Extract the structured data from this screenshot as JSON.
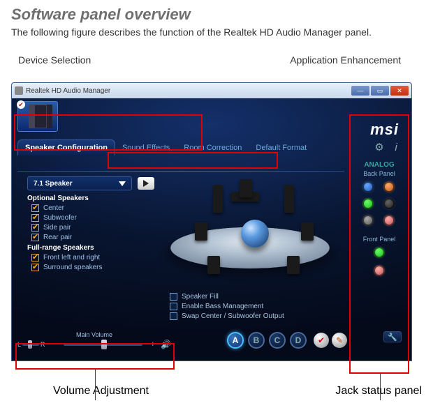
{
  "heading": "Software panel overview",
  "subhead": "The following figure describes the function of the Realtek HD Audio Manager panel.",
  "callouts": {
    "device_selection": "Device Selection",
    "application_enhancement": "Application Enhancement",
    "volume_adjustment": "Volume Adjustment",
    "jack_status_panel": "Jack status panel"
  },
  "window": {
    "title": "Realtek HD Audio Manager",
    "brand": "msi",
    "tabs": [
      {
        "label": "Speaker Configuration",
        "active": true
      },
      {
        "label": "Sound Effects",
        "active": false
      },
      {
        "label": "Room Correction",
        "active": false
      },
      {
        "label": "Default Format",
        "active": false
      }
    ],
    "speaker_mode": "7.1 Speaker",
    "optional_heading": "Optional Speakers",
    "optional": [
      {
        "label": "Center",
        "checked": true
      },
      {
        "label": "Subwoofer",
        "checked": true
      },
      {
        "label": "Side pair",
        "checked": true
      },
      {
        "label": "Rear pair",
        "checked": true
      }
    ],
    "fullrange_heading": "Full-range Speakers",
    "fullrange": [
      {
        "label": "Front left and right",
        "checked": true
      },
      {
        "label": "Surround speakers",
        "checked": true
      }
    ],
    "extra_opts": [
      {
        "label": "Speaker Fill",
        "checked": false
      },
      {
        "label": "Enable Bass Management",
        "checked": false
      },
      {
        "label": "Swap Center / Subwoofer Output",
        "checked": false
      }
    ],
    "side_panel": {
      "analog": "ANALOG",
      "back": "Back Panel",
      "front": "Front Panel"
    },
    "volume": {
      "title": "Main Volume",
      "left": "L",
      "right": "R",
      "minus": "−",
      "plus": "+"
    },
    "letter_buttons": [
      "A",
      "B",
      "C",
      "D"
    ]
  }
}
